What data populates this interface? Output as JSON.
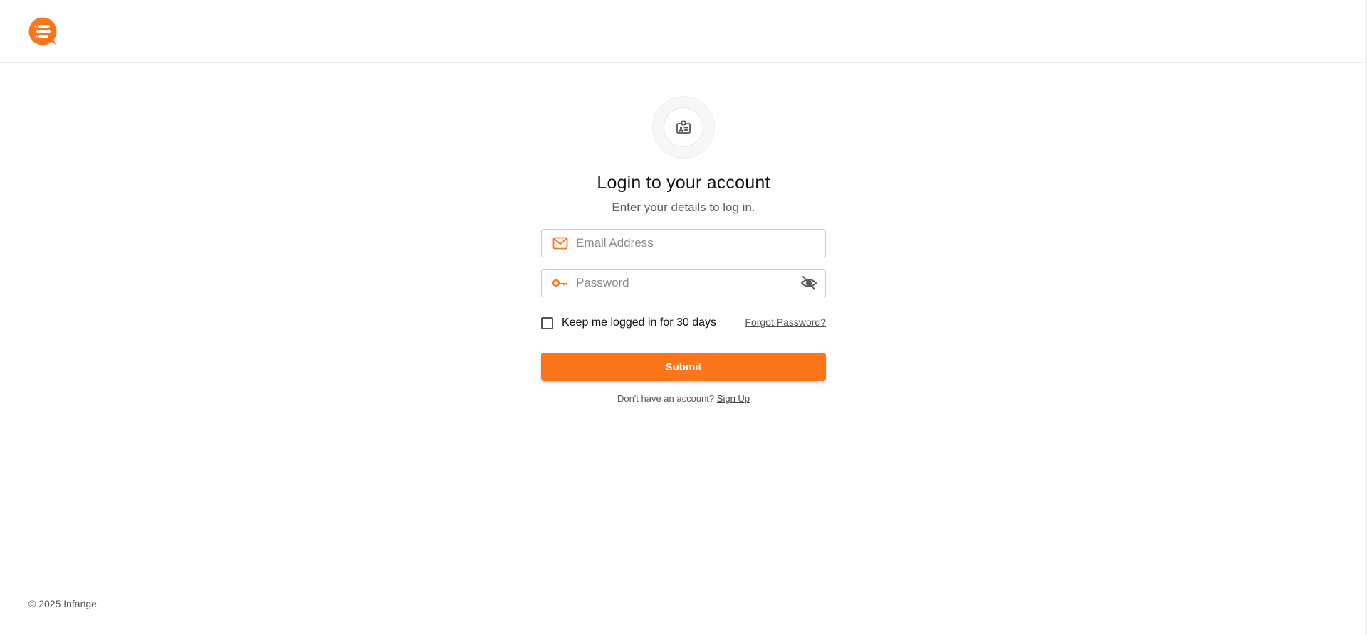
{
  "brand": {
    "logo_icon": "brand-logo-icon",
    "accent_color": "#fd7419"
  },
  "login": {
    "badge_icon": "id-badge-icon",
    "title": "Login to your account",
    "subtitle": "Enter your details to log in.",
    "email": {
      "icon": "mail-icon",
      "placeholder": "Email Address",
      "value": ""
    },
    "password": {
      "icon": "key-icon",
      "placeholder": "Password",
      "value": "",
      "toggle_icon": "eye-off-icon"
    },
    "remember_label": "Keep me logged in for 30 days",
    "remember_checked": false,
    "forgot_label": "Forgot Password?",
    "submit_label": "Submit",
    "signup_prompt": "Don't have an account?",
    "signup_link": "Sign Up"
  },
  "footer": {
    "copyright": "© 2025 Infange"
  }
}
